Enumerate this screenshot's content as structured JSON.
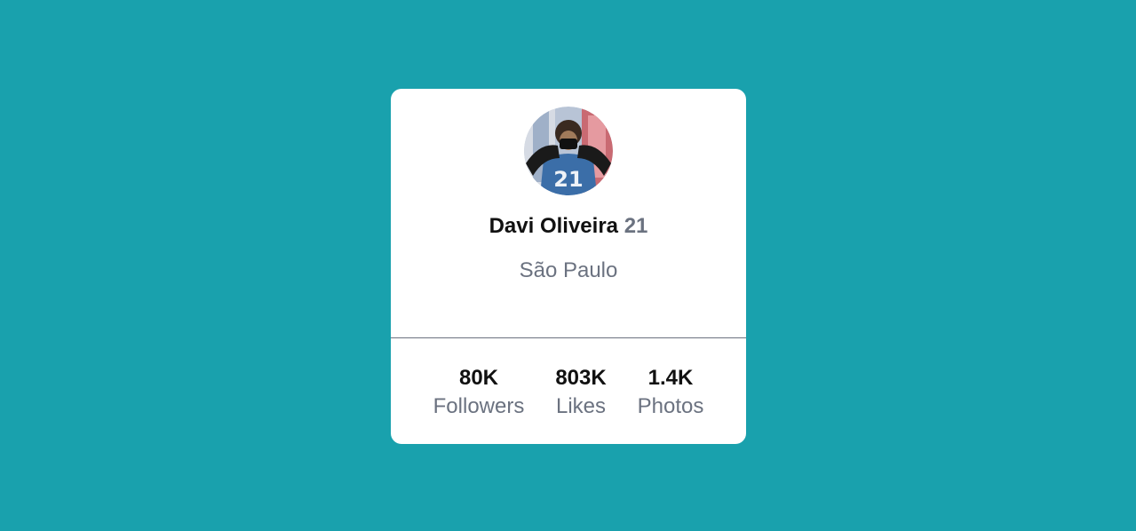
{
  "profile": {
    "name": "Davi Oliveira",
    "age": "21",
    "location": "São Paulo",
    "avatar_icon": "user-avatar-photo"
  },
  "stats": [
    {
      "value": "80K",
      "label": "Followers"
    },
    {
      "value": "803K",
      "label": "Likes"
    },
    {
      "value": "1.4K",
      "label": "Photos"
    }
  ],
  "colors": {
    "background": "#19a1ad",
    "card": "#ffffff",
    "primary_text": "#111111",
    "secondary_text": "#6b7280"
  }
}
